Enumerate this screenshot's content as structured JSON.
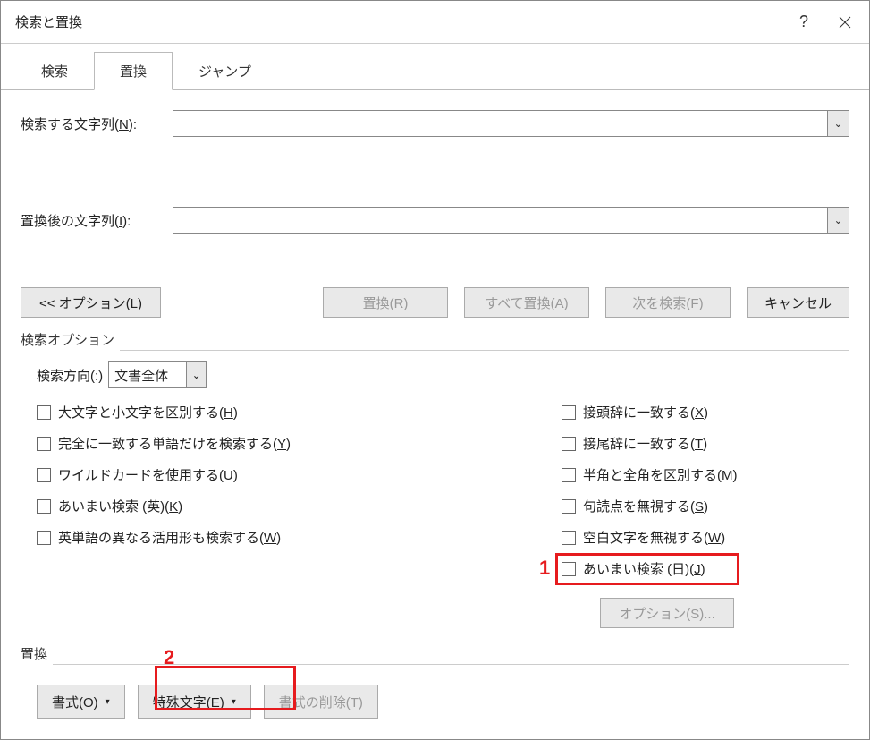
{
  "titlebar": {
    "title": "検索と置換"
  },
  "tabs": {
    "search": "検索",
    "replace": "置換",
    "jump": "ジャンプ"
  },
  "fields": {
    "find_label_pre": "検索する文字列(",
    "find_key": "N",
    "find_label_post": "):",
    "replace_label_pre": "置換後の文字列(",
    "replace_key": "I",
    "replace_label_post": "):"
  },
  "buttons": {
    "options_less": "<< オプション(L)",
    "replace": "置換(R)",
    "replace_all": "すべて置換(A)",
    "find_next": "次を検索(F)",
    "cancel": "キャンセル",
    "options_s": "オプション(S)...",
    "format": "書式(O)",
    "special": "特殊文字(E)",
    "no_format": "書式の削除(T)"
  },
  "search_options": {
    "legend": "検索オプション",
    "direction_label": "検索方向(:)",
    "direction_value": "文書全体",
    "left": [
      {
        "pre": "大文字と小文字を区別する(",
        "key": "H",
        "post": ")"
      },
      {
        "pre": "完全に一致する単語だけを検索する(",
        "key": "Y",
        "post": ")"
      },
      {
        "pre": "ワイルドカードを使用する(",
        "key": "U",
        "post": ")"
      },
      {
        "pre": "あいまい検索 (英)(",
        "key": "K",
        "post": ")"
      },
      {
        "pre": "英単語の異なる活用形も検索する(",
        "key": "W",
        "post": ")"
      }
    ],
    "right": [
      {
        "pre": "接頭辞に一致する(",
        "key": "X",
        "post": ")"
      },
      {
        "pre": "接尾辞に一致する(",
        "key": "T",
        "post": ")"
      },
      {
        "pre": "半角と全角を区別する(",
        "key": "M",
        "post": ")"
      },
      {
        "pre": "句読点を無視する(",
        "key": "S",
        "post": ")"
      },
      {
        "pre": "空白文字を無視する(",
        "key": "W",
        "post": ")"
      },
      {
        "pre": "あいまい検索 (日)(",
        "key": "J",
        "post": ")"
      }
    ]
  },
  "replace_section": {
    "legend": "置換"
  },
  "annotations": {
    "a1": "1",
    "a2": "2"
  }
}
